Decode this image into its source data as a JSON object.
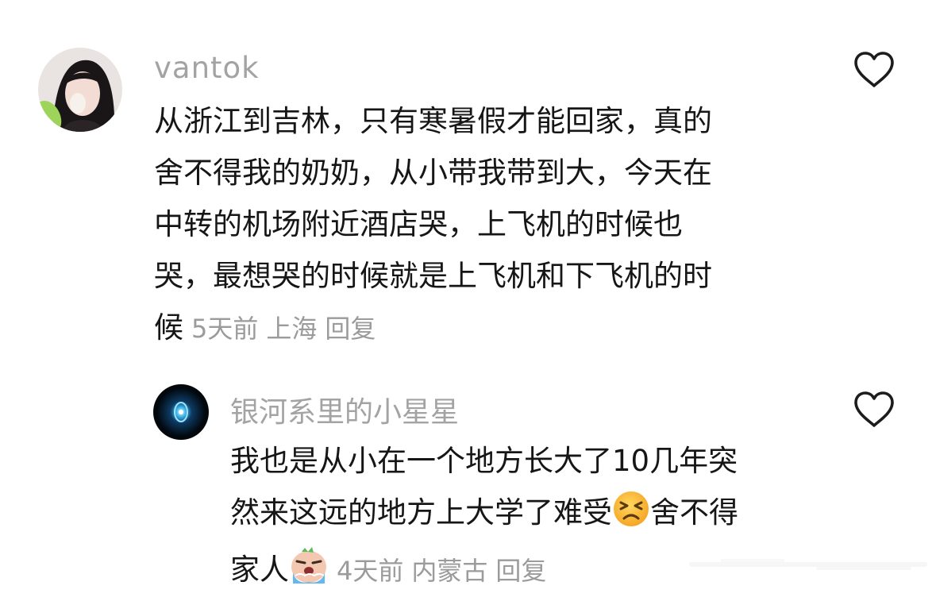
{
  "comments": [
    {
      "username": "vantok",
      "lines": [
        "从浙江到吉林，只有寒暑假才能回家，真的",
        "舍不得我的奶奶，从小带我带到大，今天在",
        "中转的机场附近酒店哭，上飞机的时候也",
        "哭，最想哭的时候就是上飞机和下飞机的时"
      ],
      "last_line": "候",
      "time": "5天前",
      "location": "上海",
      "reply": "回复"
    },
    {
      "username": "银河系里的小星星",
      "lines": [
        "我也是从小在一个地方长大了10几年突",
        "然来这远的地方上大学了难受"
      ],
      "line2_suffix": "舍不得",
      "last_line": "家人",
      "time": "4天前",
      "location": "内蒙古",
      "reply": "回复"
    }
  ],
  "icons": {
    "like": "heart-outline-icon",
    "emoji_1": "persevering-face-emoji",
    "emoji_2": "crying-face-emoji"
  },
  "colors": {
    "text": "#161616",
    "username": "#a3a3a3",
    "meta": "#9b9b9b",
    "icon_stroke": "#1c1c1c"
  }
}
